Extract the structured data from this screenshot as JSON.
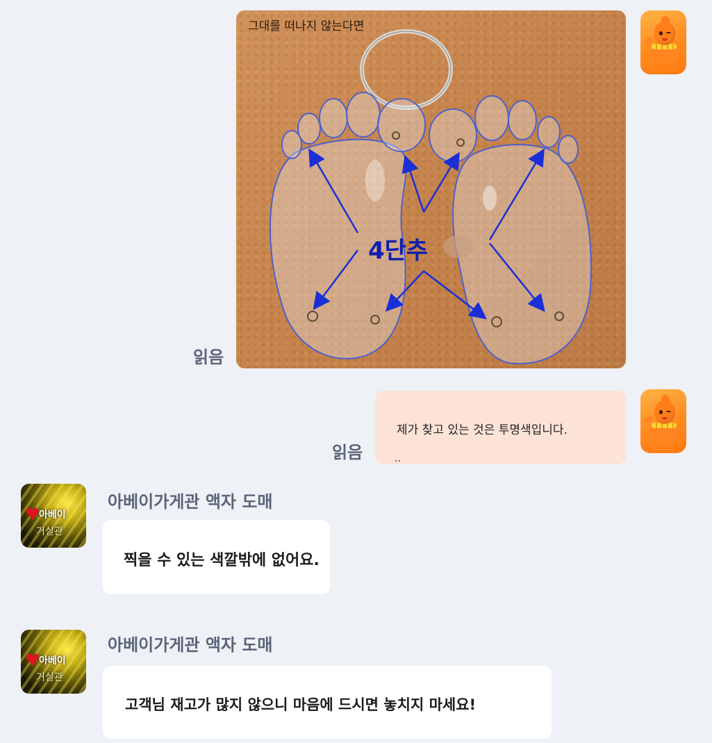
{
  "messages": [
    {
      "type": "image",
      "read_status": "읽음",
      "image": {
        "caption_text": "그대를 떠나지 않는다면",
        "center_label": "4단추"
      }
    },
    {
      "type": "text",
      "read_status": "읽음",
      "text": "제가 찾고 있는 것은 투명색입니다.",
      "trailing": ".."
    },
    {
      "type": "text",
      "sender": "아베이가게관 액자 도매",
      "avatar": {
        "line1": "아베이",
        "line2": "거실관"
      },
      "text": "찍을 수 있는 색깔밖에 없어요."
    },
    {
      "type": "text",
      "sender": "아베이가게관 액자 도매",
      "avatar": {
        "line1": "아베이",
        "line2": "거실관"
      },
      "text": "고객님 재고가 많지 않으니 마음에 드시면 놓치지 마세요!"
    }
  ],
  "icons": {
    "self_avatar": "orange-mascot-icon",
    "shop_avatar": "shop-logo-icon",
    "heart": "heart-icon"
  },
  "colors": {
    "background": "#eef1f5",
    "self_bubble": "#fde3d6",
    "other_bubble": "#ffffff",
    "meta_text": "#5b6478",
    "arrow": "#1a2fd6"
  }
}
